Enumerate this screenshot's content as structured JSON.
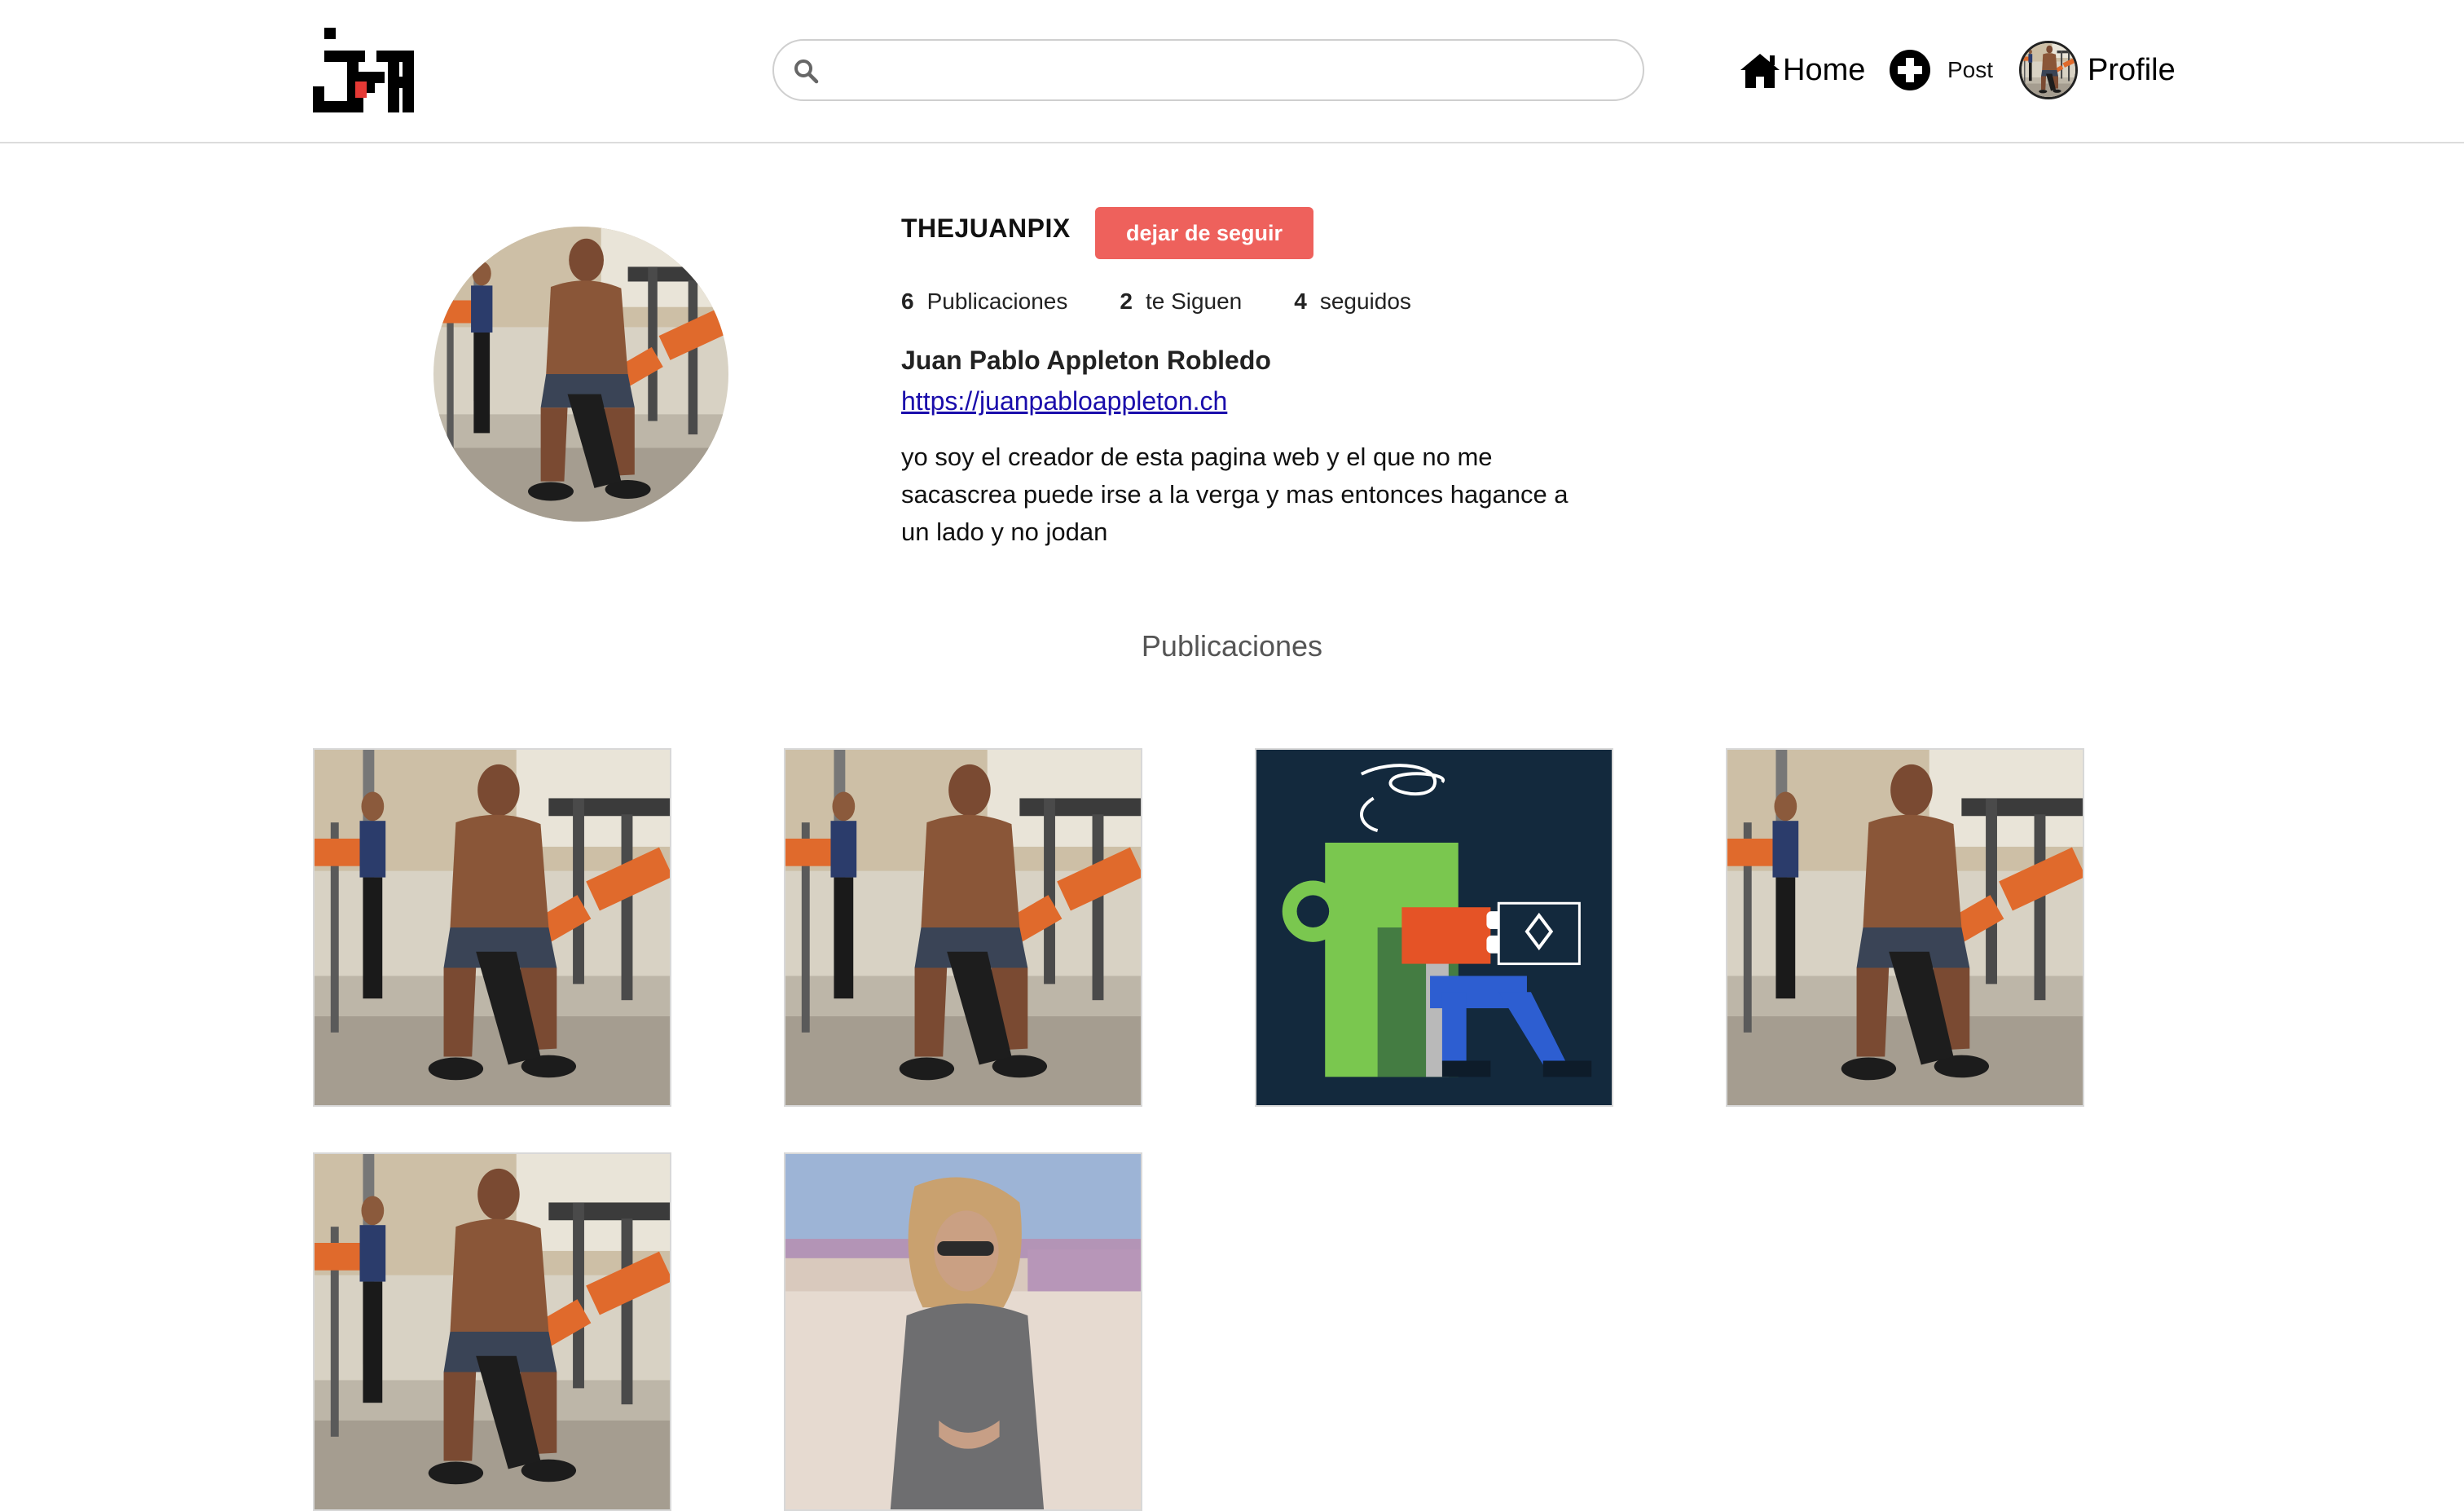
{
  "header": {
    "search": {
      "placeholder": "",
      "value": ""
    },
    "nav": {
      "home_label": "Home",
      "post_label": "Post",
      "profile_label": "Profile"
    }
  },
  "profile": {
    "username": "THEJUANPIX",
    "unfollow_label": "dejar de seguir",
    "stats": {
      "posts_count": "6",
      "posts_label": "Publicaciones",
      "followers_count": "2",
      "followers_label": "te Siguen",
      "following_count": "4",
      "following_label": "seguidos"
    },
    "full_name": "Juan Pablo Appleton Robledo",
    "website": "https://juanpabloappleton.ch",
    "bio": "yo soy el creador de esta pagina web y el que no me sacascrea puede irse a la verga y mas entonces hagance a un lado y no jodan"
  },
  "posts": {
    "heading": "Publicaciones",
    "items": [
      {
        "kind": "gym-photo"
      },
      {
        "kind": "gym-photo"
      },
      {
        "kind": "coffee-illustration"
      },
      {
        "kind": "gym-photo"
      },
      {
        "kind": "gym-photo"
      },
      {
        "kind": "beach-photo"
      }
    ]
  },
  "colors": {
    "accent": "#ee615c",
    "link": "#1a0dab",
    "border": "#dcdcdc",
    "illustration_bg": "#13293d"
  },
  "icons": {
    "logo": "jpa-logo",
    "search": "search-icon",
    "home": "home-icon",
    "post": "plus-circle-icon"
  }
}
